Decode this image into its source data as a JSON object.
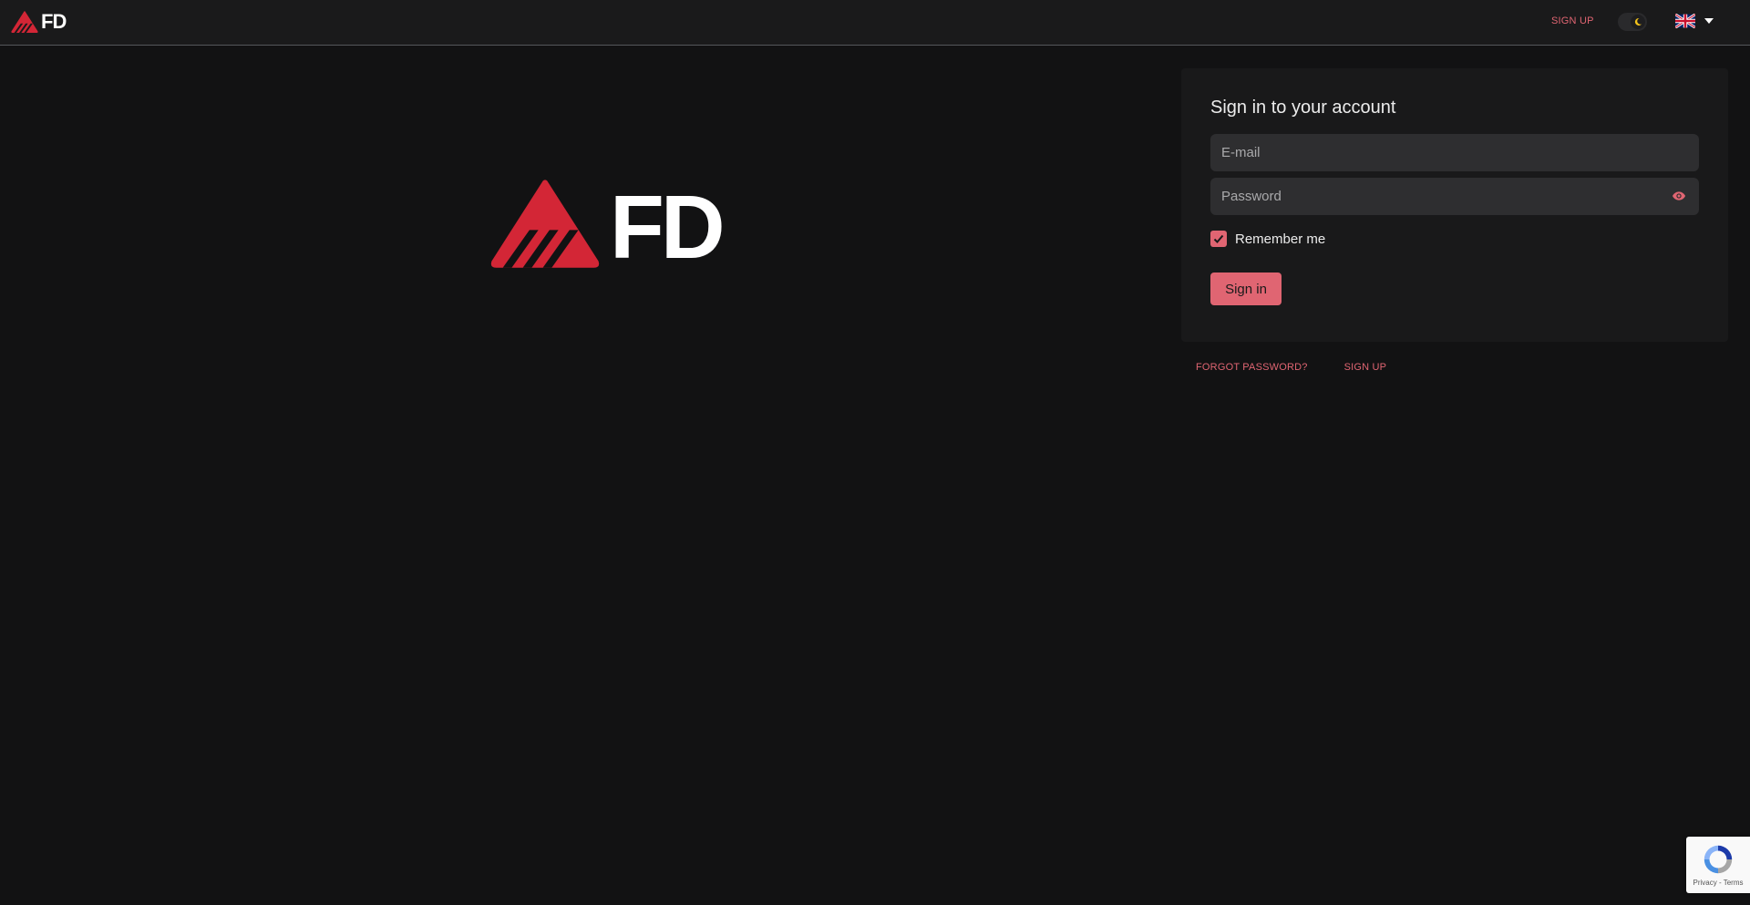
{
  "header": {
    "brand_text": "FD",
    "signup_label": "SIGN UP",
    "theme_toggle": {
      "mode": "dark",
      "icon": "moon-icon"
    },
    "language": {
      "flag": "uk-flag-icon"
    }
  },
  "hero": {
    "brand_text": "FD"
  },
  "login": {
    "title": "Sign in to your account",
    "email_placeholder": "E-mail",
    "email_value": "",
    "password_placeholder": "Password",
    "password_value": "",
    "remember_label": "Remember me",
    "remember_checked": true,
    "submit_label": "Sign in"
  },
  "footer_links": {
    "forgot_label": "FORGOT PASSWORD?",
    "signup_label": "SIGN UP"
  },
  "recaptcha": {
    "links": "Privacy - Terms"
  },
  "colors": {
    "accent": "#e06572",
    "logo_red": "#d32636",
    "background": "#121213",
    "card": "#19191a",
    "input": "#2e2e30"
  }
}
